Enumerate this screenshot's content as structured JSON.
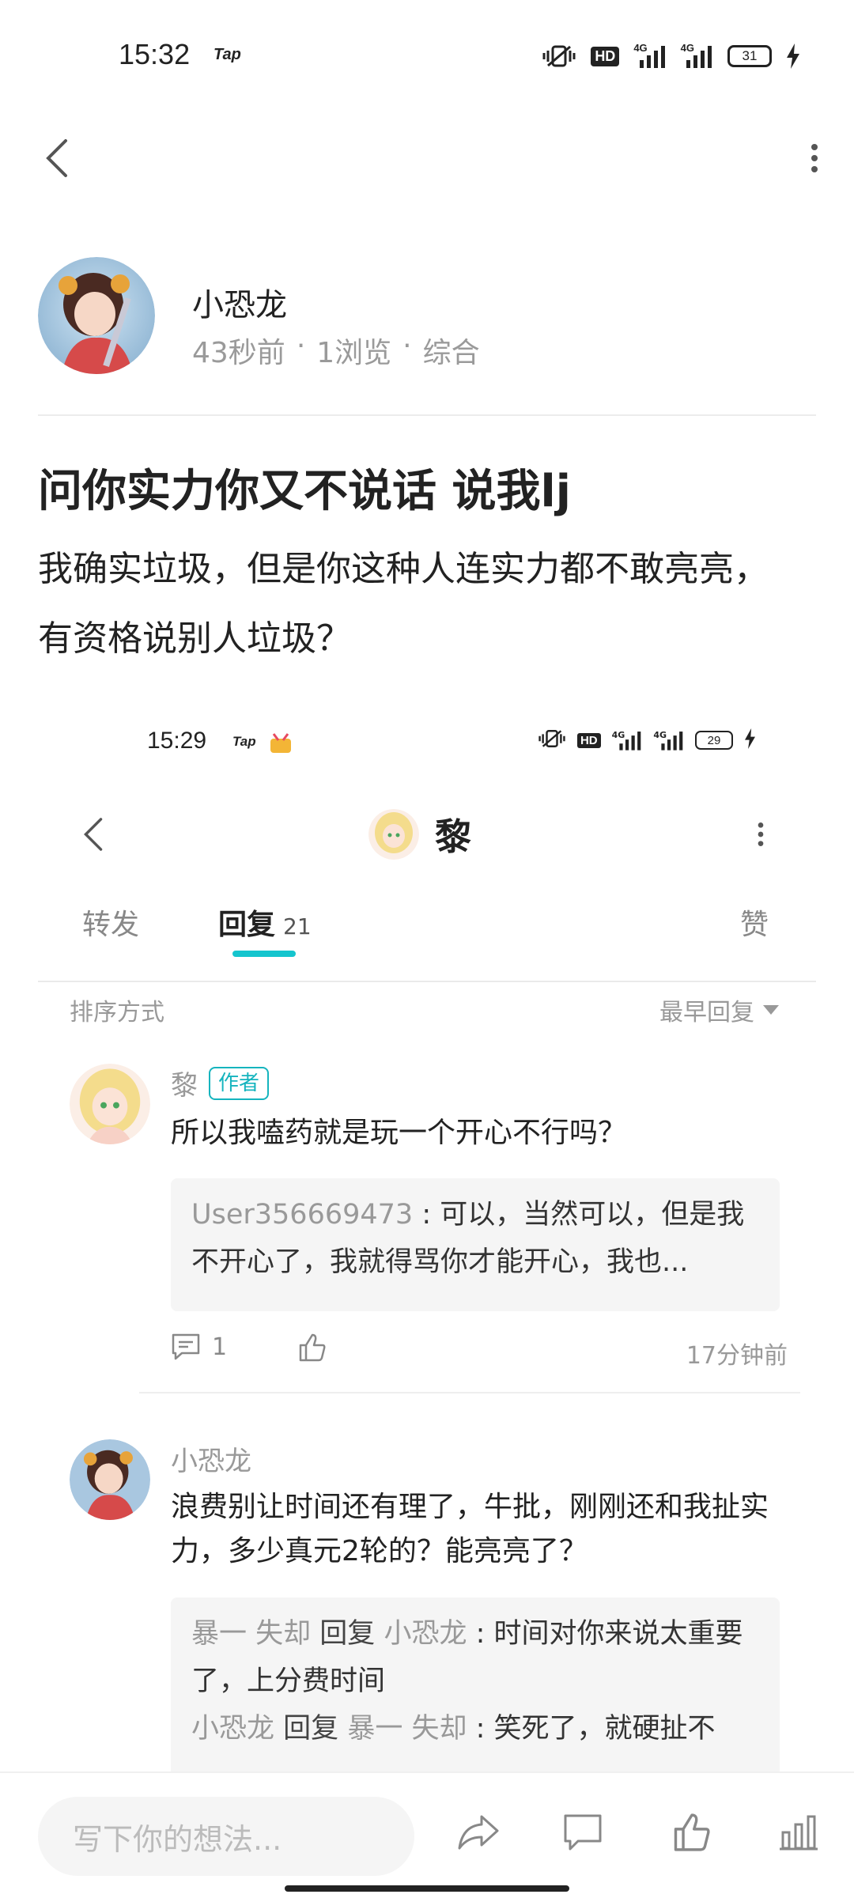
{
  "status_bar": {
    "time": "15:32",
    "tap_label": "Tap",
    "hd_label": "HD",
    "net1": "4G",
    "net2": "4G",
    "battery": "31"
  },
  "post": {
    "author_name": "小恐龙",
    "meta": {
      "time_ago": "43秒前",
      "sep": "·",
      "views": "1浏览",
      "category": "综合"
    },
    "title": "问你实力你又不说话 说我lj",
    "body": "我确实垃圾，但是你这种人连实力都不敢亮亮，有资格说别人垃圾？"
  },
  "embedded": {
    "status_bar": {
      "time": "15:29",
      "tap_label": "Tap",
      "hd_label": "HD",
      "net1": "4G",
      "net2": "4G",
      "battery": "29"
    },
    "nav": {
      "title": "黎"
    },
    "tabs": {
      "forward": "转发",
      "reply": "回复",
      "reply_count": "21",
      "like": "赞"
    },
    "sort": {
      "label": "排序方式",
      "option": "最早回复"
    },
    "comments": [
      {
        "name": "黎",
        "tag": "作者",
        "text": "所以我嗑药就是玩一个开心不行吗？",
        "quote_user": "User356669473",
        "quote_text": " : 可以，当然可以，但是我不开心了，我就得骂你才能开心，我也...",
        "reply_count": "1",
        "time_ago": "17分钟前"
      },
      {
        "name": "小恐龙",
        "text": "浪费别让时间还有理了，牛批，刚刚还和我扯实力，多少真元2轮的？能亮亮了？",
        "replies": [
          {
            "from": "暴一 失却",
            "verb": "回复",
            "to": "小恐龙",
            "text": " : 时间对你来说太重要了，上分费时间"
          },
          {
            "from": "小恐龙",
            "verb": "回复",
            "to": "暴一 失却",
            "text": " : 笑死了，就硬扯不"
          }
        ]
      }
    ]
  },
  "bottom_bar": {
    "input_placeholder": "写下你的想法..."
  },
  "colors": {
    "accent": "#15c5ce",
    "muted": "#999999",
    "text": "#222222"
  }
}
